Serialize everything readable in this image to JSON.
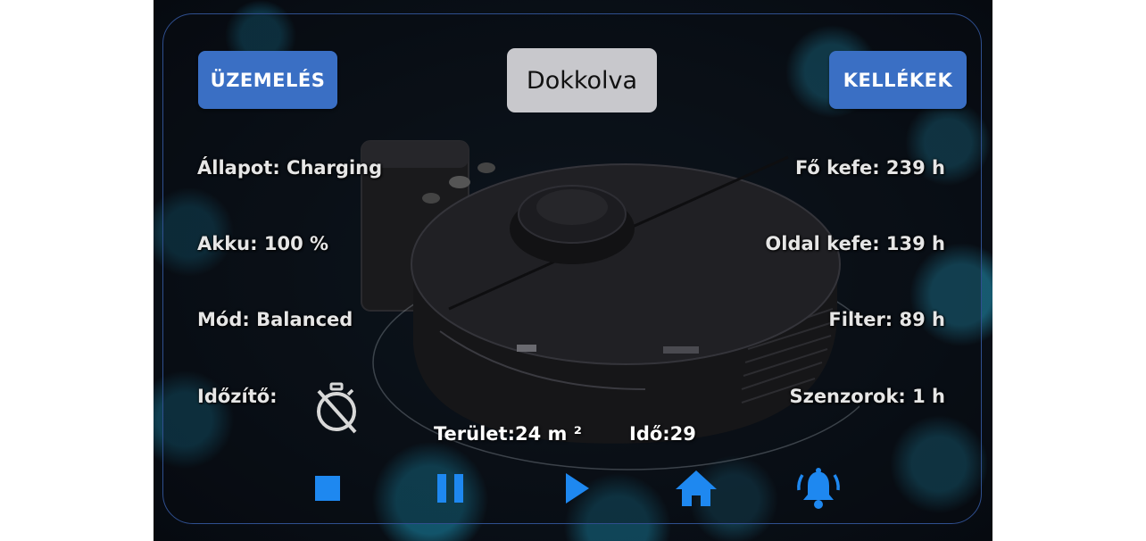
{
  "header": {
    "left_button": "ÜZEMELÉS",
    "status": "Dokkolva",
    "right_button": "KELLÉKEK"
  },
  "left_info": [
    "Állapot: Charging",
    "Akku: 100 %",
    "Mód: Balanced",
    "Időzítő:"
  ],
  "right_info": [
    "Fő kefe: 239 h",
    "Oldal kefe: 139 h",
    "Filter: 89 h",
    "Szenzorok: 1 h"
  ],
  "timer_icon": "timer-off-icon",
  "stats": {
    "area": "Terület:24 m ²",
    "time": "Idő:29"
  },
  "controls": [
    {
      "icon": "stop-icon"
    },
    {
      "icon": "pause-icon"
    },
    {
      "icon": "play-icon"
    },
    {
      "icon": "home-icon"
    },
    {
      "icon": "bell-icon"
    }
  ],
  "colors": {
    "accent": "#3a6fc4",
    "control": "#1e88f0",
    "status_bg": "#c8c8cc",
    "frame_border": "#2f4f8f"
  }
}
